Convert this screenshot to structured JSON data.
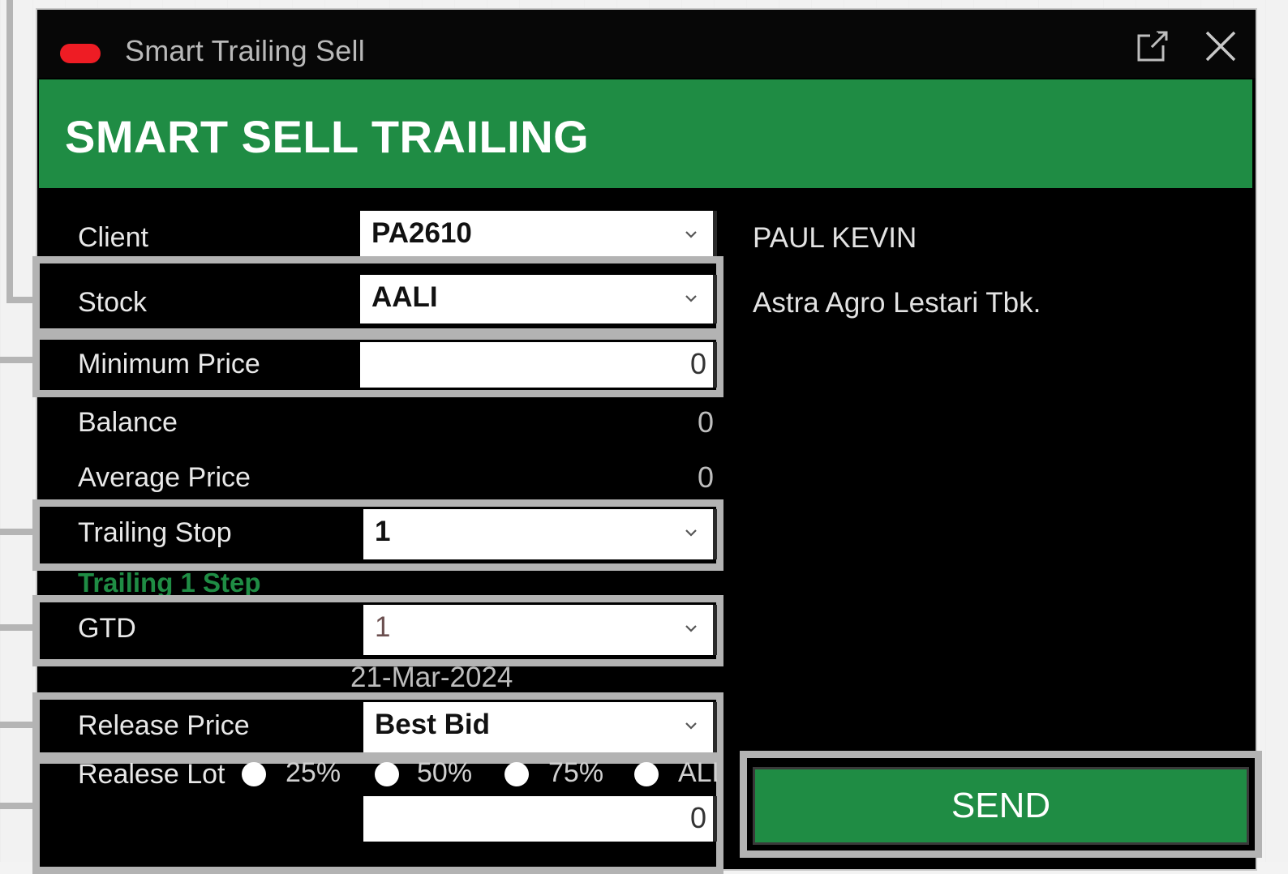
{
  "window": {
    "title": "Smart Trailing Sell",
    "header": "SMART SELL TRAILING"
  },
  "form": {
    "client": {
      "label": "Client",
      "value": "PA2610",
      "name": "PAUL KEVIN"
    },
    "stock": {
      "label": "Stock",
      "value": "AALI",
      "name": "Astra Agro Lestari Tbk."
    },
    "minimum_price": {
      "label": "Minimum Price",
      "value": "0"
    },
    "balance": {
      "label": "Balance",
      "value": "0"
    },
    "average_price": {
      "label": "Average Price",
      "value": "0"
    },
    "trailing_stop": {
      "label": "Trailing Stop",
      "value": "1",
      "hint": "Trailing 1 Step"
    },
    "gtd": {
      "label": "GTD",
      "value": "1",
      "date": "21-Mar-2024"
    },
    "release_price": {
      "label": "Release Price",
      "value": "Best Bid"
    },
    "release_lot": {
      "label": "Realese Lot",
      "options": [
        "25%",
        "50%",
        "75%",
        "ALL"
      ],
      "value": "0"
    }
  },
  "actions": {
    "send_label": "SEND"
  },
  "icons": {
    "popout": "external-window-icon",
    "close": "close-icon",
    "chevron": "chevron-down-icon"
  },
  "colors": {
    "accent_green": "#1f8c44",
    "title_pill": "#ee1c24",
    "highlight_frame": "#b3b3b3",
    "window_bg": "#000000"
  }
}
